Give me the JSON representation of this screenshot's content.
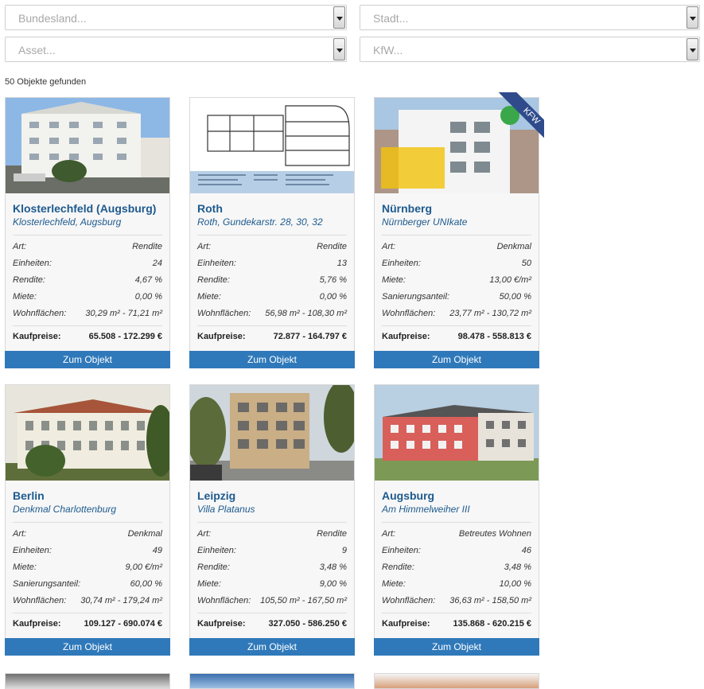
{
  "filters": {
    "bundesland": "Bundesland...",
    "stadt": "Stadt...",
    "asset": "Asset...",
    "kfw": "KfW..."
  },
  "result_count": "50 Objekte gefunden",
  "button_label": "Zum Objekt",
  "price_label": "Kaufpreise:",
  "cards": [
    {
      "title": "Klosterlechfeld (Augsburg)",
      "subtitle": "Klosterlechfeld, Augsburg",
      "rows": [
        {
          "k": "Art:",
          "v": "Rendite"
        },
        {
          "k": "Einheiten:",
          "v": "24"
        },
        {
          "k": "Rendite:",
          "v": "4,67 %"
        },
        {
          "k": "Miete:",
          "v": "0,00 %"
        },
        {
          "k": "Wohnflächen:",
          "v": "30,29 m² - 71,21 m²"
        }
      ],
      "price": "65.508 - 172.299 €"
    },
    {
      "title": "Roth",
      "subtitle": "Roth, Gundekarstr. 28, 30, 32",
      "rows": [
        {
          "k": "Art:",
          "v": "Rendite"
        },
        {
          "k": "Einheiten:",
          "v": "13"
        },
        {
          "k": "Rendite:",
          "v": "5,76 %"
        },
        {
          "k": "Miete:",
          "v": "0,00 %"
        },
        {
          "k": "Wohnflächen:",
          "v": "56,98 m² - 108,30 m²"
        }
      ],
      "price": "72.877 - 164.797 €"
    },
    {
      "title": "Nürnberg",
      "subtitle": "Nürnberger UNIkate",
      "ribbon": "KFW",
      "rows": [
        {
          "k": "Art:",
          "v": "Denkmal"
        },
        {
          "k": "Einheiten:",
          "v": "50"
        },
        {
          "k": "Miete:",
          "v": "13,00 €/m²"
        },
        {
          "k": "Sanierungsanteil:",
          "v": "50,00 %"
        },
        {
          "k": "Wohnflächen:",
          "v": "23,77 m² - 130,72 m²"
        }
      ],
      "price": "98.478 - 558.813 €"
    },
    {
      "title": "Berlin",
      "subtitle": "Denkmal Charlottenburg",
      "rows": [
        {
          "k": "Art:",
          "v": "Denkmal"
        },
        {
          "k": "Einheiten:",
          "v": "49"
        },
        {
          "k": "Miete:",
          "v": "9,00 €/m²"
        },
        {
          "k": "Sanierungsanteil:",
          "v": "60,00 %"
        },
        {
          "k": "Wohnflächen:",
          "v": "30,74 m² - 179,24 m²"
        }
      ],
      "price": "109.127 - 690.074 €"
    },
    {
      "title": "Leipzig",
      "subtitle": "Villa Platanus",
      "rows": [
        {
          "k": "Art:",
          "v": "Rendite"
        },
        {
          "k": "Einheiten:",
          "v": "9"
        },
        {
          "k": "Rendite:",
          "v": "3,48 %"
        },
        {
          "k": "Miete:",
          "v": "9,00 %"
        },
        {
          "k": "Wohnflächen:",
          "v": "105,50 m² - 167,50 m²"
        }
      ],
      "price": "327.050 - 586.250 €"
    },
    {
      "title": "Augsburg",
      "subtitle": "Am Himmelweiher III",
      "rows": [
        {
          "k": "Art:",
          "v": "Betreutes Wohnen"
        },
        {
          "k": "Einheiten:",
          "v": "46"
        },
        {
          "k": "Rendite:",
          "v": "3,48 %"
        },
        {
          "k": "Miete:",
          "v": "10,00 %"
        },
        {
          "k": "Wohnflächen:",
          "v": "36,63 m² - 158,50 m²"
        }
      ],
      "price": "135.868 - 620.215 €"
    }
  ]
}
